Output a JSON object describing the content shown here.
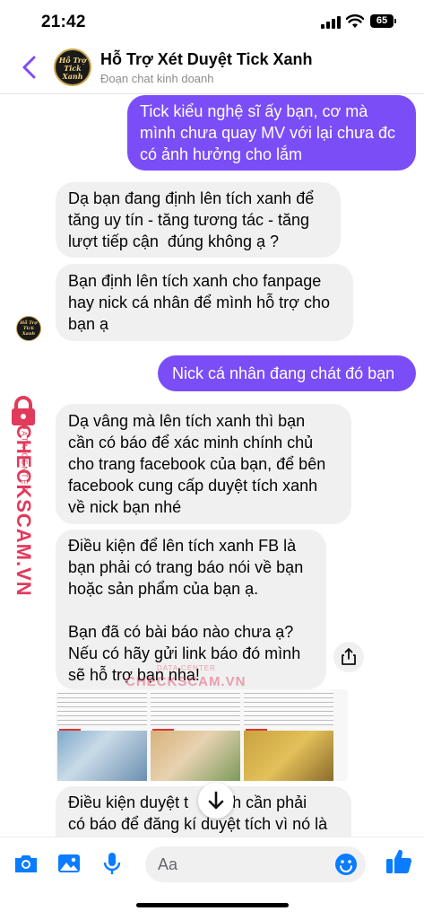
{
  "status_bar": {
    "time": "21:42",
    "battery": "65"
  },
  "header": {
    "title": "Hỗ Trợ Xét Duyệt Tick Xanh",
    "subtitle": "Đoạn chat kinh doanh",
    "avatar_text": "Hỗ Trợ Tick Xanh"
  },
  "messages": [
    {
      "id": "m1",
      "direction": "outgoing",
      "text": "Tick kiểu nghệ sĩ ấy bạn, cơ mà\nmình chưa quay MV với lại chưa đc\ncó ảnh hưởng cho lắm"
    },
    {
      "id": "m2",
      "direction": "incoming",
      "text": "Dạ bạn đang định lên tích xanh để\ntăng uy tín - tăng tương tác - tăng\nlượt tiếp cận  đúng không ạ ?"
    },
    {
      "id": "m3",
      "direction": "incoming",
      "text": "Bạn định lên tích xanh cho fanpage\nhay nick cá nhân để mình hỗ trợ cho\nbạn ạ"
    },
    {
      "id": "m4",
      "direction": "outgoing",
      "text": "Nick cá nhân đang chát đó bạn"
    },
    {
      "id": "m5",
      "direction": "incoming",
      "text": "Dạ vâng mà lên tích xanh thì bạn\ncần có báo để xác minh chính chủ\ncho trang facebook của bạn, để bên\nfacebook cung cấp duyệt tích xanh\nvề nick bạn nhé"
    },
    {
      "id": "m6",
      "direction": "incoming",
      "text": "Điều kiện để lên tích xanh FB là\nbạn phải có trang báo nói về bạn\nhoặc sản phẩm của bạn ạ.\n\nBạn đã có bài báo nào chưa ạ?\nNếu có hãy gửi link báo đó mình\nsẽ hỗ trợ bạn nha!"
    },
    {
      "id": "m7",
      "direction": "incoming",
      "text": "Điều kiện duyệt t    xanh cần phải\ncó báo để đăng kí duyệt tích vì nó là"
    }
  ],
  "watermark": {
    "brand": "CHECKSCAM.VN",
    "sub": "DATA CENTER"
  },
  "news_tags": [
    "Kinh nghiệm",
    "Kinh nghiệm",
    "Kinh nghiệm"
  ],
  "composer": {
    "placeholder": "Aa"
  },
  "colors": {
    "accent": "#7b4df7",
    "incoming_bg": "#f0f0f0",
    "icon_blue": "#0a7cff",
    "watermark": "#e23a5b"
  }
}
